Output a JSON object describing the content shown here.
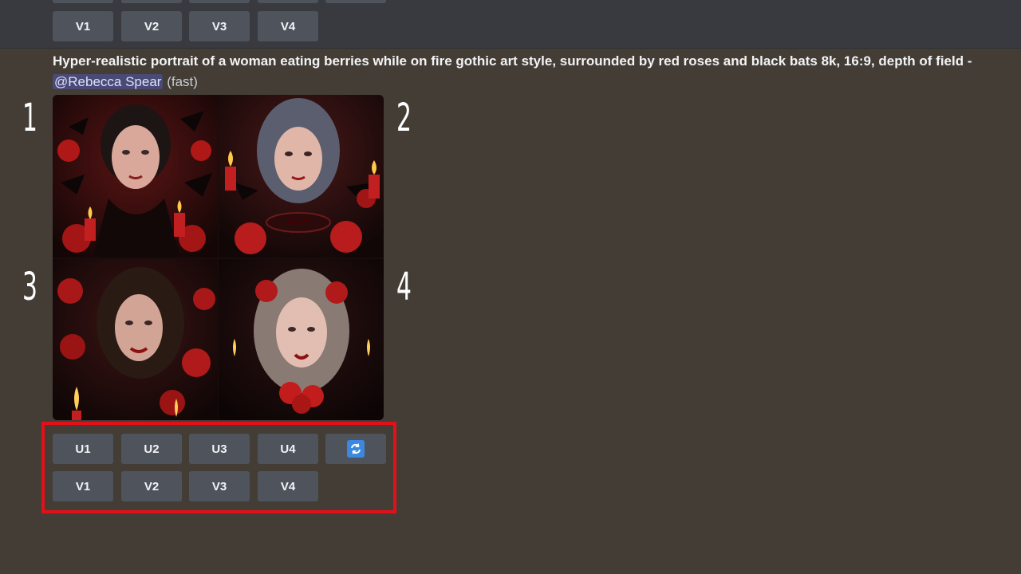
{
  "top_buttons": [
    "V1",
    "V2",
    "V3",
    "V4"
  ],
  "prompt": {
    "text": "Hyper-realistic portrait of a woman eating berries while on fire gothic art style, surrounded by red roses and black bats 8k, 16:9, depth of field -",
    "mention": "@Rebecca Spear",
    "speed": "(fast)"
  },
  "grid_labels": [
    "1",
    "2",
    "3",
    "4"
  ],
  "images": [
    {
      "name": "gothic-portrait-1",
      "icon": "image"
    },
    {
      "name": "gothic-portrait-2",
      "icon": "image"
    },
    {
      "name": "gothic-portrait-3",
      "icon": "image"
    },
    {
      "name": "gothic-portrait-4",
      "icon": "image"
    }
  ],
  "upscale_buttons": [
    "U1",
    "U2",
    "U3",
    "U4"
  ],
  "variation_buttons": [
    "V1",
    "V2",
    "V3",
    "V4"
  ],
  "reroll_icon": "refresh-icon",
  "colors": {
    "background": "#433d36",
    "button": "#4f545c",
    "highlight": "#e3101a",
    "reroll": "#3b88e0"
  }
}
